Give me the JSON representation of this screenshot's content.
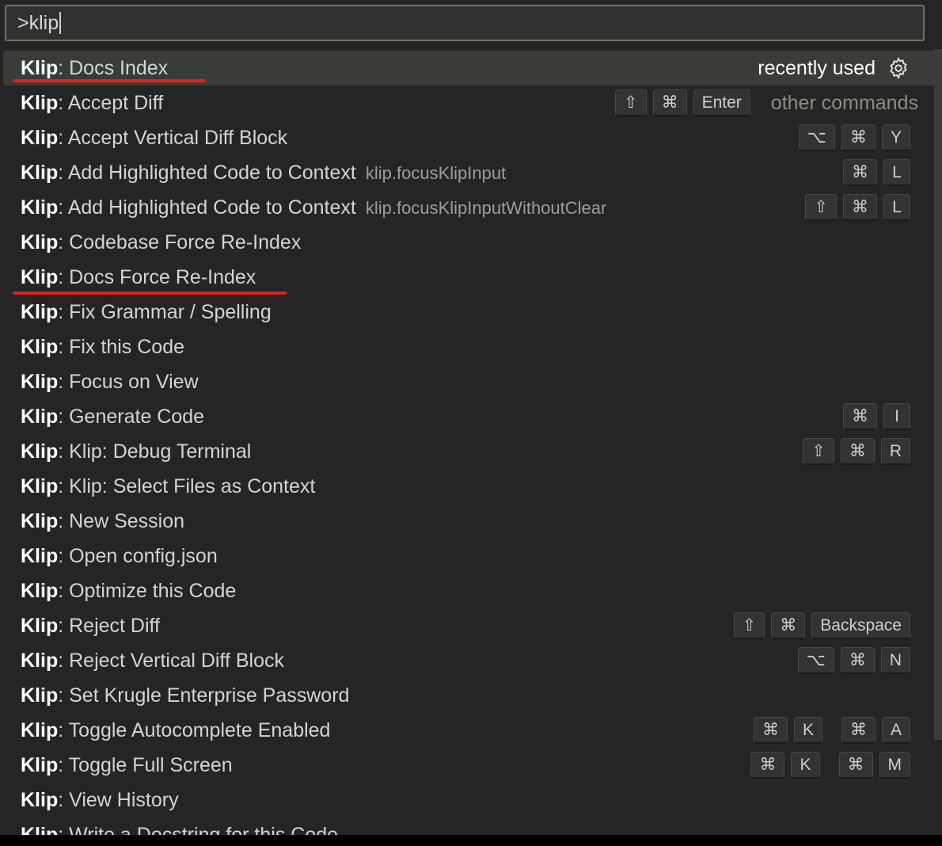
{
  "search": {
    "value": ">klip"
  },
  "rows": [
    {
      "prefix": "Klip",
      "label": ": Docs Index",
      "badge": "recently used"
    },
    {
      "prefix": "Klip",
      "label": ": Accept Diff",
      "keys": [
        "⇧",
        "⌘",
        "Enter"
      ],
      "badge": "other commands"
    },
    {
      "prefix": "Klip",
      "label": ": Accept Vertical Diff Block",
      "keys": [
        "⌥",
        "⌘",
        "Y"
      ]
    },
    {
      "prefix": "Klip",
      "label": ": Add Highlighted Code to Context",
      "desc": "klip.focusKlipInput",
      "keys": [
        "⌘",
        "L"
      ]
    },
    {
      "prefix": "Klip",
      "label": ": Add Highlighted Code to Context",
      "desc": "klip.focusKlipInputWithoutClear",
      "keys": [
        "⇧",
        "⌘",
        "L"
      ]
    },
    {
      "prefix": "Klip",
      "label": ": Codebase Force Re-Index"
    },
    {
      "prefix": "Klip",
      "label": ": Docs Force Re-Index"
    },
    {
      "prefix": "Klip",
      "label": ": Fix Grammar / Spelling"
    },
    {
      "prefix": "Klip",
      "label": ": Fix this Code"
    },
    {
      "prefix": "Klip",
      "label": ": Focus on  View"
    },
    {
      "prefix": "Klip",
      "label": ": Generate Code",
      "keys": [
        "⌘",
        "I"
      ]
    },
    {
      "prefix": "Klip",
      "label": ": Klip: Debug Terminal",
      "keys": [
        "⇧",
        "⌘",
        "R"
      ]
    },
    {
      "prefix": "Klip",
      "label": ": Klip: Select Files as Context"
    },
    {
      "prefix": "Klip",
      "label": ": New Session"
    },
    {
      "prefix": "Klip",
      "label": ": Open config.json"
    },
    {
      "prefix": "Klip",
      "label": ": Optimize this Code"
    },
    {
      "prefix": "Klip",
      "label": ": Reject Diff",
      "keys": [
        "⇧",
        "⌘",
        "Backspace"
      ]
    },
    {
      "prefix": "Klip",
      "label": ": Reject Vertical Diff Block",
      "keys": [
        "⌥",
        "⌘",
        "N"
      ]
    },
    {
      "prefix": "Klip",
      "label": ": Set Krugle Enterprise Password"
    },
    {
      "prefix": "Klip",
      "label": ": Toggle Autocomplete Enabled",
      "chords": [
        [
          "⌘",
          "K"
        ],
        [
          "⌘",
          "A"
        ]
      ]
    },
    {
      "prefix": "Klip",
      "label": ": Toggle Full Screen",
      "chords": [
        [
          "⌘",
          "K"
        ],
        [
          "⌘",
          "M"
        ]
      ]
    },
    {
      "prefix": "Klip",
      "label": ": View History"
    },
    {
      "prefix": "Klip",
      "label": ": Write a Docstring for this Code"
    }
  ],
  "colors": {
    "highlight_underline": "#e02020",
    "selected_row": "#3a3d37"
  }
}
